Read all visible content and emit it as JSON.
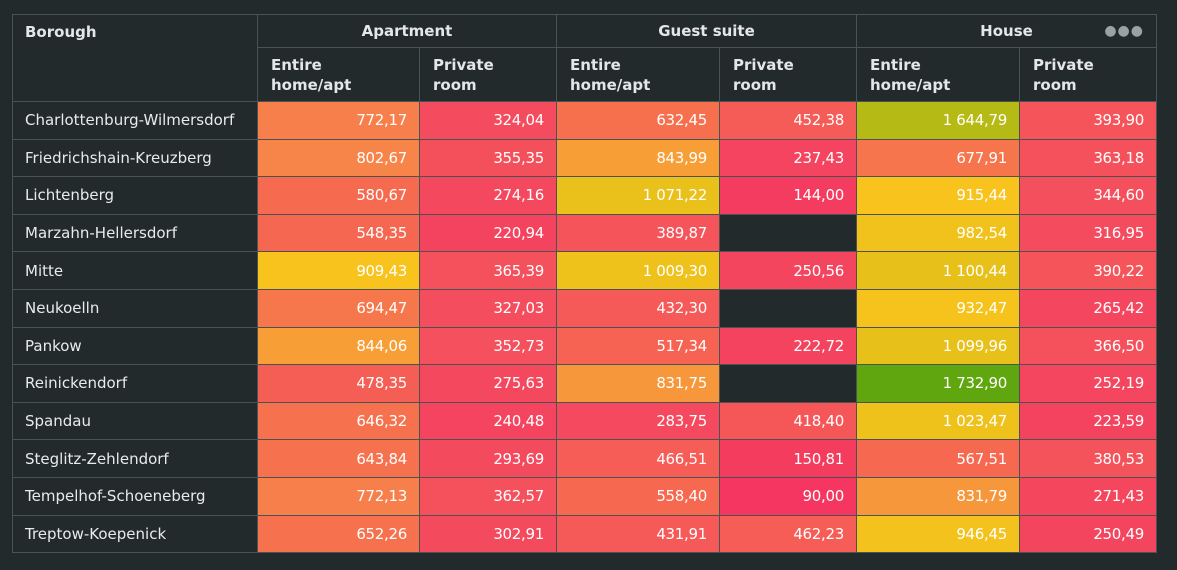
{
  "table": {
    "row_header": "Borough",
    "groups": [
      {
        "label": "Apartment",
        "subcolumns": [
          "Entire\nhome/apt",
          "Private\nroom"
        ]
      },
      {
        "label": "Guest suite",
        "subcolumns": [
          "Entire\nhome/apt",
          "Private\nroom"
        ]
      },
      {
        "label": "House",
        "subcolumns": [
          "Entire\nhome/apt",
          "Private\nroom"
        ]
      }
    ],
    "subcolumn_labels": {
      "entire": [
        "Entire",
        "home/apt"
      ],
      "private": [
        "Private",
        "room"
      ]
    },
    "menu_icon": "more-horizontal-icon",
    "rows": [
      {
        "borough": "Charlottenburg-Wilmersdorf",
        "values": [
          "772,17",
          "324,04",
          "632,45",
          "452,38",
          "1 644,79",
          "393,90"
        ]
      },
      {
        "borough": "Friedrichshain-Kreuzberg",
        "values": [
          "802,67",
          "355,35",
          "843,99",
          "237,43",
          "677,91",
          "363,18"
        ]
      },
      {
        "borough": "Lichtenberg",
        "values": [
          "580,67",
          "274,16",
          "1 071,22",
          "144,00",
          "915,44",
          "344,60"
        ]
      },
      {
        "borough": "Marzahn-Hellersdorf",
        "values": [
          "548,35",
          "220,94",
          "389,87",
          "",
          "982,54",
          "316,95"
        ]
      },
      {
        "borough": "Mitte",
        "values": [
          "909,43",
          "365,39",
          "1 009,30",
          "250,56",
          "1 100,44",
          "390,22"
        ]
      },
      {
        "borough": "Neukoelln",
        "values": [
          "694,47",
          "327,03",
          "432,30",
          "",
          "932,47",
          "265,42"
        ]
      },
      {
        "borough": "Pankow",
        "values": [
          "844,06",
          "352,73",
          "517,34",
          "222,72",
          "1 099,96",
          "366,50"
        ]
      },
      {
        "borough": "Reinickendorf",
        "values": [
          "478,35",
          "275,63",
          "831,75",
          "",
          "1 732,90",
          "252,19"
        ]
      },
      {
        "borough": "Spandau",
        "values": [
          "646,32",
          "240,48",
          "283,75",
          "418,40",
          "1 023,47",
          "223,59"
        ]
      },
      {
        "borough": "Steglitz-Zehlendorf",
        "values": [
          "643,84",
          "293,69",
          "466,51",
          "150,81",
          "567,51",
          "380,53"
        ]
      },
      {
        "borough": "Tempelhof-Schoeneberg",
        "values": [
          "772,13",
          "362,57",
          "558,40",
          "90,00",
          "831,79",
          "271,43"
        ]
      },
      {
        "borough": "Treptow-Koepenick",
        "values": [
          "652,26",
          "302,91",
          "431,91",
          "462,23",
          "946,45",
          "250,49"
        ]
      }
    ]
  },
  "colors": {
    "background": "#232a2b",
    "scale_low": "#f43d63",
    "scale_mid_low": "#f5714c",
    "scale_mid": "#f98a45",
    "scale_high": "#f5c518",
    "scale_top": "#5ea60e"
  }
}
